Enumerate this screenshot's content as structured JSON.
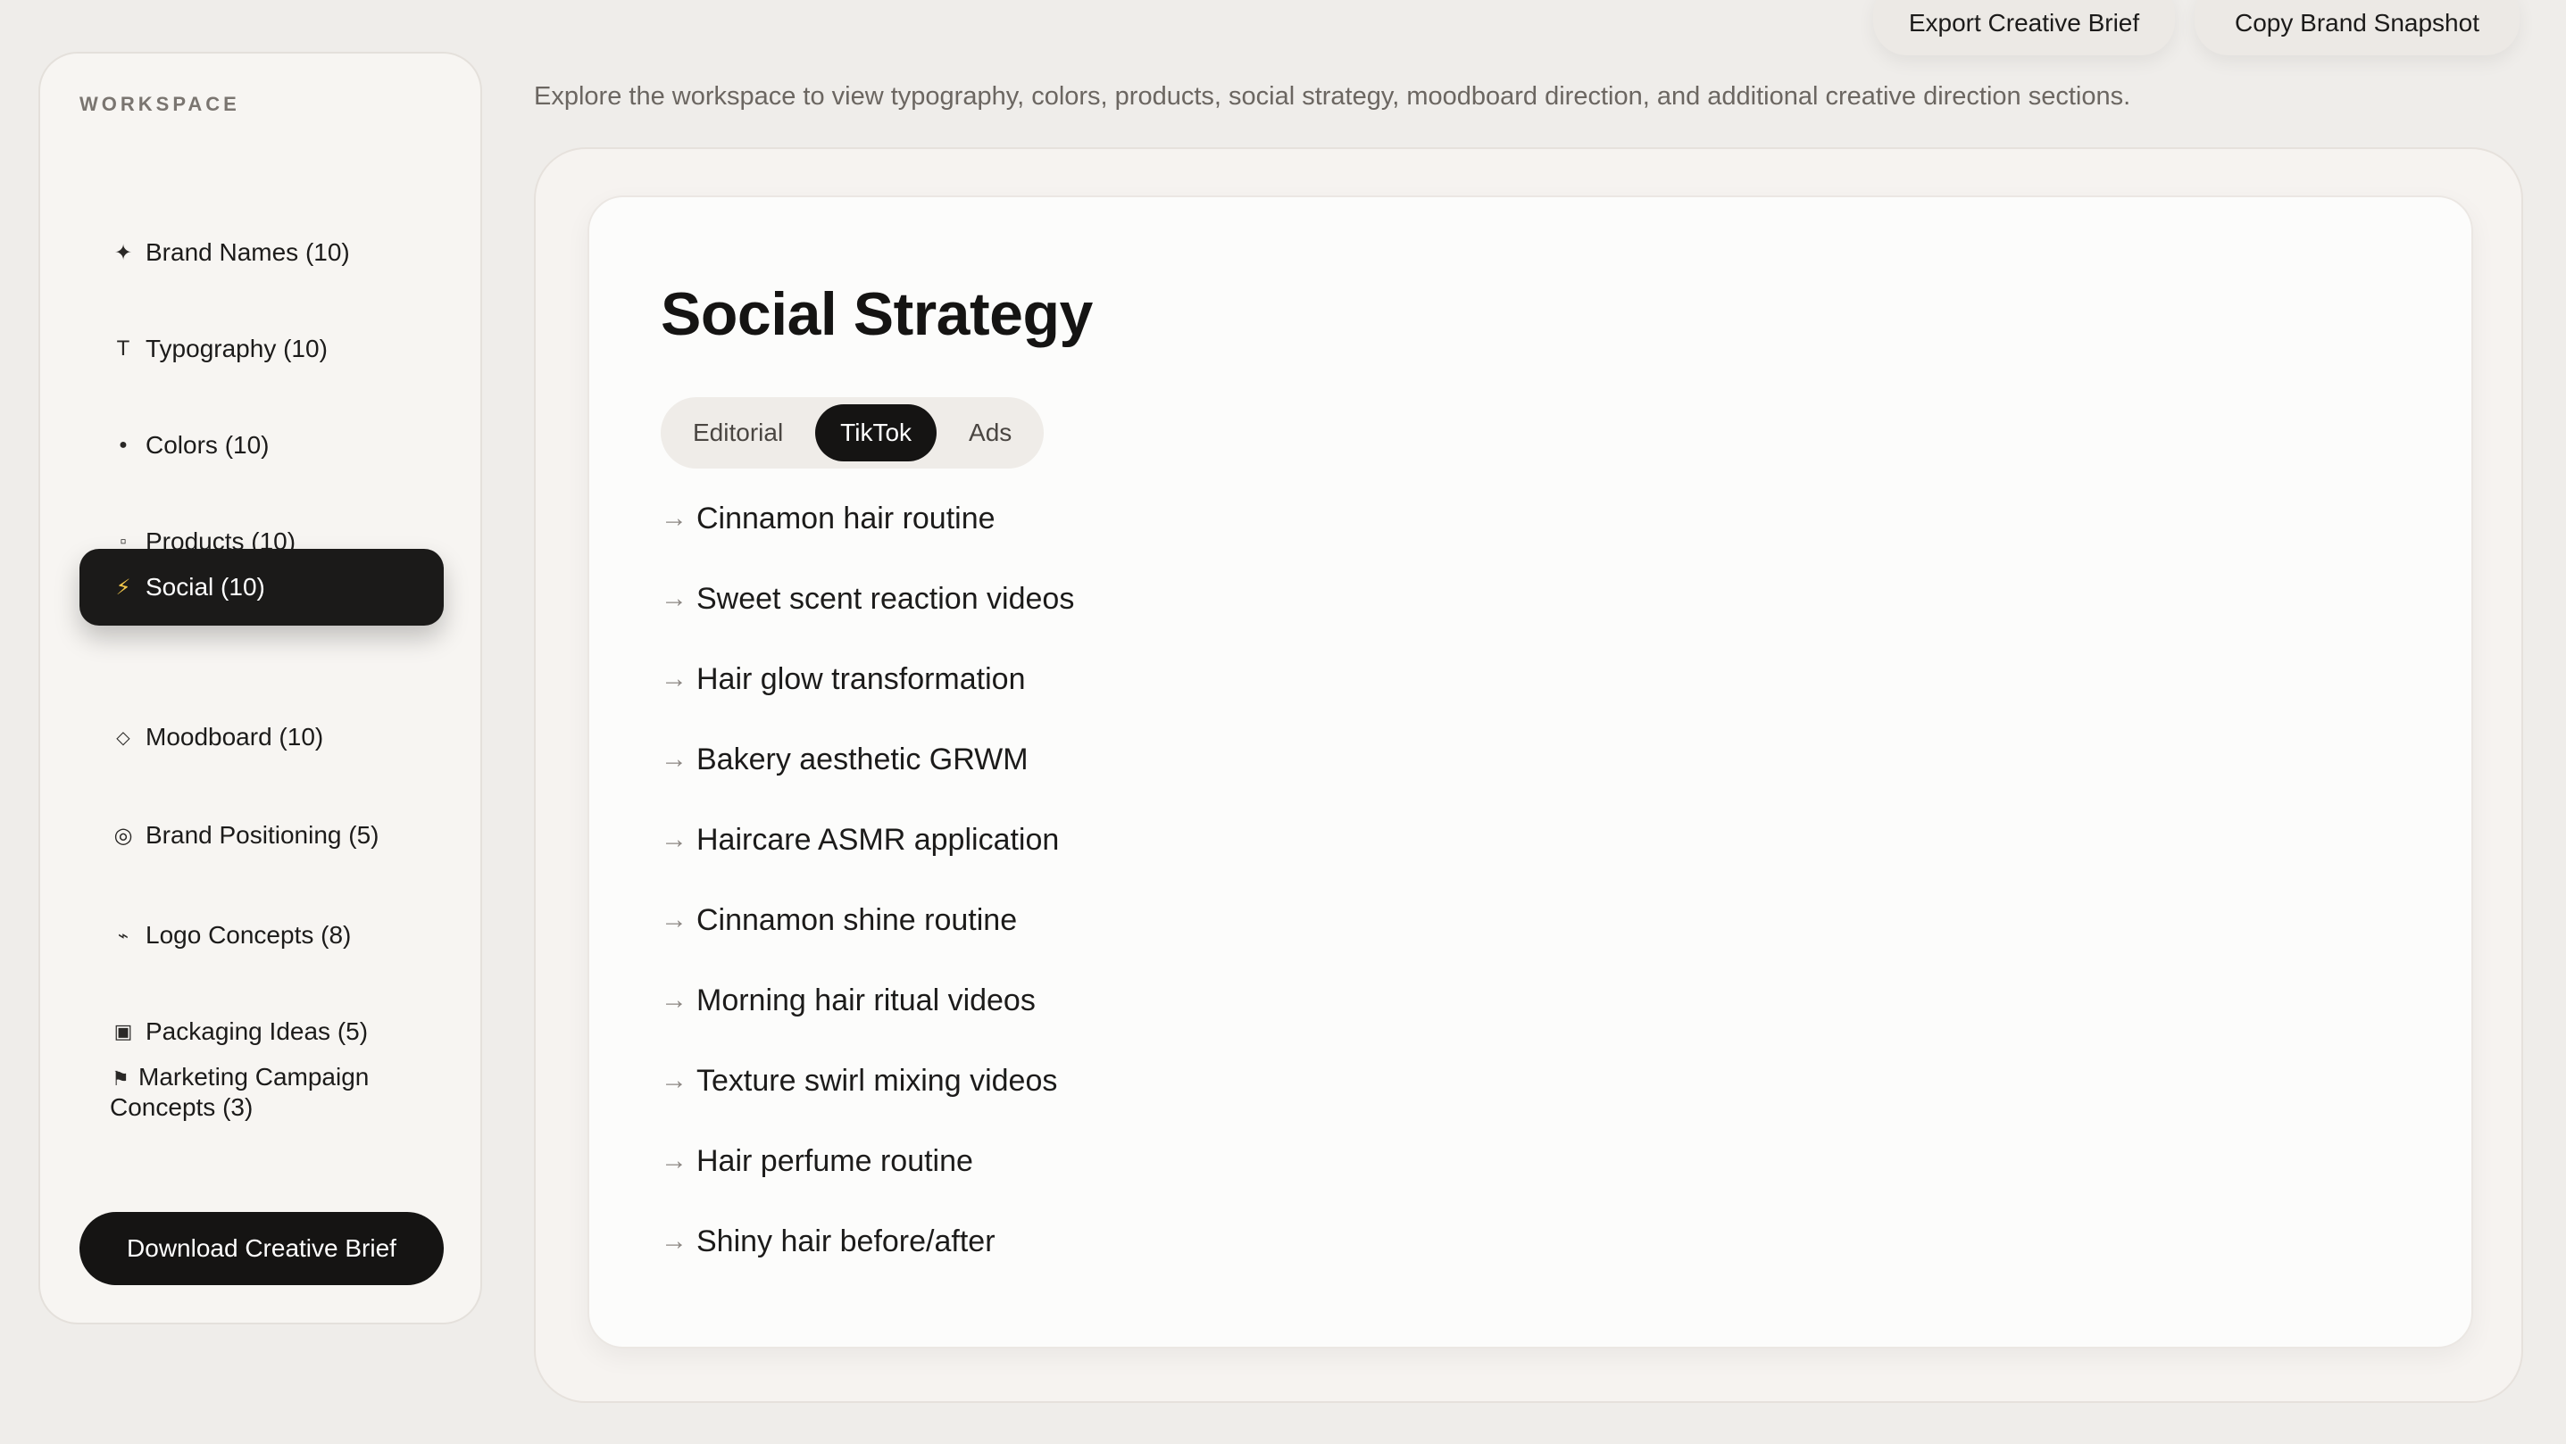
{
  "header": {
    "export_label": "Export Creative Brief",
    "copy_label": "Copy Brand Snapshot"
  },
  "sidebar": {
    "heading": "WORKSPACE",
    "items": [
      {
        "icon": "sparkle-icon",
        "glyph": "✦",
        "label": "Brand Names (10)"
      },
      {
        "icon": "typography-icon",
        "glyph": "T",
        "label": "Typography (10)"
      },
      {
        "icon": "dot-icon",
        "glyph": "●",
        "label": "Colors (10)"
      },
      {
        "icon": "square-icon",
        "glyph": "▫",
        "label": "Products (10)"
      },
      {
        "icon": "lightning-icon",
        "glyph": "⚡",
        "label": "Social (10)",
        "active": true
      },
      {
        "icon": "diamond-icon",
        "glyph": "◇",
        "label": "Moodboard (10)"
      },
      {
        "icon": "target-icon",
        "glyph": "◎",
        "label": "Brand Positioning (5)"
      },
      {
        "icon": "squiggle-icon",
        "glyph": "⌁",
        "label": "Logo Concepts (8)"
      },
      {
        "icon": "box-icon",
        "glyph": "▣",
        "label": "Packaging Ideas (5)"
      },
      {
        "icon": "flag-icon",
        "glyph": "⚑",
        "label": "Marketing Campaign Concepts (3)"
      }
    ],
    "download_label": "Download Creative Brief"
  },
  "intro_text": "Explore the workspace to view typography, colors, products, social strategy, moodboard direction, and additional creative direction sections.",
  "main": {
    "title": "Social Strategy",
    "tabs": [
      {
        "label": "Editorial",
        "active": false
      },
      {
        "label": "TikTok",
        "active": true
      },
      {
        "label": "Ads",
        "active": false
      }
    ],
    "arrow_glyph": "→",
    "ideas": [
      "Cinnamon hair routine",
      "Sweet scent reaction videos",
      "Hair glow transformation",
      "Bakery aesthetic GRWM",
      "Haircare ASMR application",
      "Cinnamon shine routine",
      "Morning hair ritual videos",
      "Texture swirl mixing videos",
      "Hair perfume routine",
      "Shiny hair before/after"
    ]
  },
  "colors": {
    "background": "#efedea",
    "active_dark": "#151413",
    "lightning_accent": "#f1c64a"
  }
}
